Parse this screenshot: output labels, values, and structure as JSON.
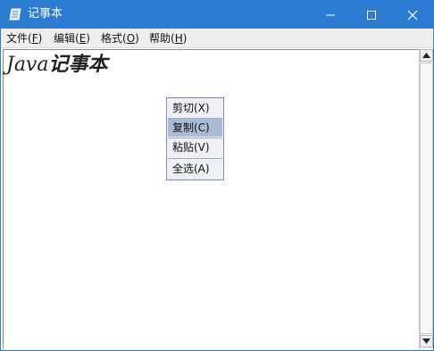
{
  "window": {
    "title": "记事本",
    "controls": {
      "minimize": "minimize-icon",
      "maximize": "maximize-icon",
      "close": "close-icon"
    },
    "accent": "#2b7bd3"
  },
  "menubar": {
    "items": [
      {
        "label": "文件(",
        "mnemonic": "F",
        "suffix": ")"
      },
      {
        "label": "编辑(",
        "mnemonic": "E",
        "suffix": ")"
      },
      {
        "label": "格式(",
        "mnemonic": "O",
        "suffix": ")"
      },
      {
        "label": "帮助(",
        "mnemonic": "H",
        "suffix": ")"
      }
    ]
  },
  "editor": {
    "text_latin": "Java",
    "text_cjk": "记事本"
  },
  "context_menu": {
    "items": [
      {
        "label": "剪切(X)"
      },
      {
        "label": "复制(C)",
        "highlighted": true
      },
      {
        "label": "粘贴(V)"
      },
      {
        "label": "全选(A)"
      }
    ],
    "highlight_color": "#aabbd3"
  },
  "scrollbar": {
    "up": "scroll-up-arrow-icon",
    "down": "scroll-down-arrow-icon"
  }
}
